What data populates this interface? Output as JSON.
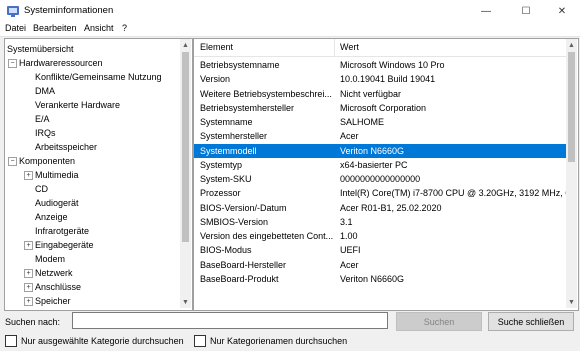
{
  "window": {
    "title": "Systeminformationen",
    "minimize": "—",
    "maximize": "☐",
    "close": "✕"
  },
  "menu": [
    "Datei",
    "Bearbeiten",
    "Ansicht",
    "?"
  ],
  "tree": [
    {
      "label": "Systemübersicht",
      "level": 0,
      "expander": ""
    },
    {
      "label": "Hardwareressourcen",
      "level": 0,
      "expander": "−"
    },
    {
      "label": "Konflikte/Gemeinsame Nutzung",
      "level": 1,
      "expander": ""
    },
    {
      "label": "DMA",
      "level": 1,
      "expander": ""
    },
    {
      "label": "Verankerte Hardware",
      "level": 1,
      "expander": ""
    },
    {
      "label": "E/A",
      "level": 1,
      "expander": ""
    },
    {
      "label": "IRQs",
      "level": 1,
      "expander": ""
    },
    {
      "label": "Arbeitsspeicher",
      "level": 1,
      "expander": ""
    },
    {
      "label": "Komponenten",
      "level": 0,
      "expander": "−"
    },
    {
      "label": "Multimedia",
      "level": 1,
      "expander": "+"
    },
    {
      "label": "CD",
      "level": 1,
      "expander": ""
    },
    {
      "label": "Audiogerät",
      "level": 1,
      "expander": ""
    },
    {
      "label": "Anzeige",
      "level": 1,
      "expander": ""
    },
    {
      "label": "Infrarotgeräte",
      "level": 1,
      "expander": ""
    },
    {
      "label": "Eingabegeräte",
      "level": 1,
      "expander": "+"
    },
    {
      "label": "Modem",
      "level": 1,
      "expander": ""
    },
    {
      "label": "Netzwerk",
      "level": 1,
      "expander": "+"
    },
    {
      "label": "Anschlüsse",
      "level": 1,
      "expander": "+"
    },
    {
      "label": "Speicher",
      "level": 1,
      "expander": "+"
    }
  ],
  "table": {
    "headers": [
      "Element",
      "Wert"
    ],
    "rows": [
      {
        "element": "Betriebsystemname",
        "value": "Microsoft Windows 10 Pro"
      },
      {
        "element": "Version",
        "value": "10.0.19041 Build 19041"
      },
      {
        "element": "Weitere Betriebsystembeschrei...",
        "value": "Nicht verfügbar"
      },
      {
        "element": "Betriebsystemhersteller",
        "value": "Microsoft Corporation"
      },
      {
        "element": "Systemname",
        "value": "SALHOME"
      },
      {
        "element": "Systemhersteller",
        "value": "Acer"
      },
      {
        "element": "Systemmodell",
        "value": "Veriton N6660G",
        "selected": true
      },
      {
        "element": "Systemtyp",
        "value": "x64-basierter PC"
      },
      {
        "element": "System-SKU",
        "value": "0000000000000000"
      },
      {
        "element": "Prozessor",
        "value": "Intel(R) Core(TM) i7-8700 CPU @ 3.20GHz, 3192 MHz, 6 Ke"
      },
      {
        "element": "BIOS-Version/-Datum",
        "value": "Acer R01-B1, 25.02.2020"
      },
      {
        "element": "SMBIOS-Version",
        "value": "3.1"
      },
      {
        "element": "Version des eingebetteten Cont...",
        "value": "1.00"
      },
      {
        "element": "BIOS-Modus",
        "value": "UEFI"
      },
      {
        "element": "BaseBoard-Hersteller",
        "value": "Acer"
      },
      {
        "element": "BaseBoard-Produkt",
        "value": "Veriton N6660G"
      }
    ]
  },
  "search": {
    "label": "Suchen nach:",
    "value": "",
    "search_button": "Suchen",
    "close_button": "Suche schließen",
    "checkbox_selected_category": "Nur ausgewählte Kategorie durchsuchen",
    "checkbox_category_names": "Nur Kategorienamen durchsuchen"
  },
  "colors": {
    "selection": "#0078d7",
    "icon": "#4a6fc9"
  }
}
